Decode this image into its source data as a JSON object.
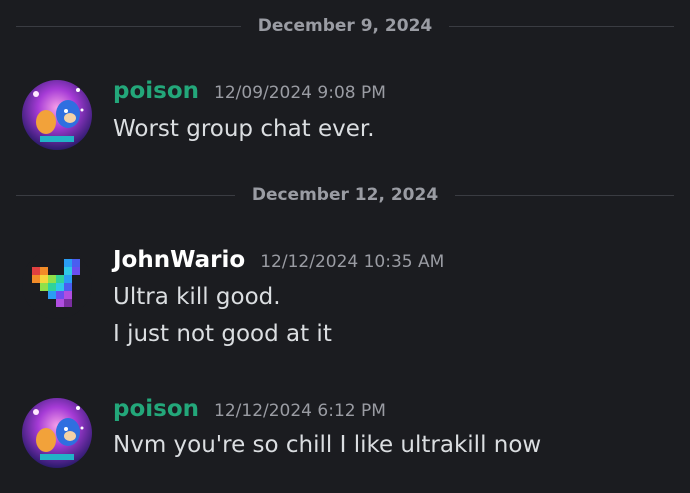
{
  "dividers": [
    {
      "date": "December 9, 2024"
    },
    {
      "date": "December 12, 2024"
    }
  ],
  "messages": [
    {
      "username": "poison",
      "username_color": "#23a77a",
      "timestamp": "12/09/2024 9:08 PM",
      "avatar_icon": "sonic-character-avatar",
      "lines": [
        "Worst group chat ever."
      ]
    },
    {
      "username": "JohnWario",
      "username_color": "#ffffff",
      "timestamp": "12/12/2024 10:35 AM",
      "avatar_icon": "rainbow-pixel-heart-avatar",
      "lines": [
        "Ultra kill good.",
        "I just not good at it"
      ]
    },
    {
      "username": "poison",
      "username_color": "#23a77a",
      "timestamp": "12/12/2024 6:12 PM",
      "avatar_icon": "sonic-character-avatar",
      "lines": [
        "Nvm you're so chill I like ultrakill now"
      ]
    }
  ]
}
